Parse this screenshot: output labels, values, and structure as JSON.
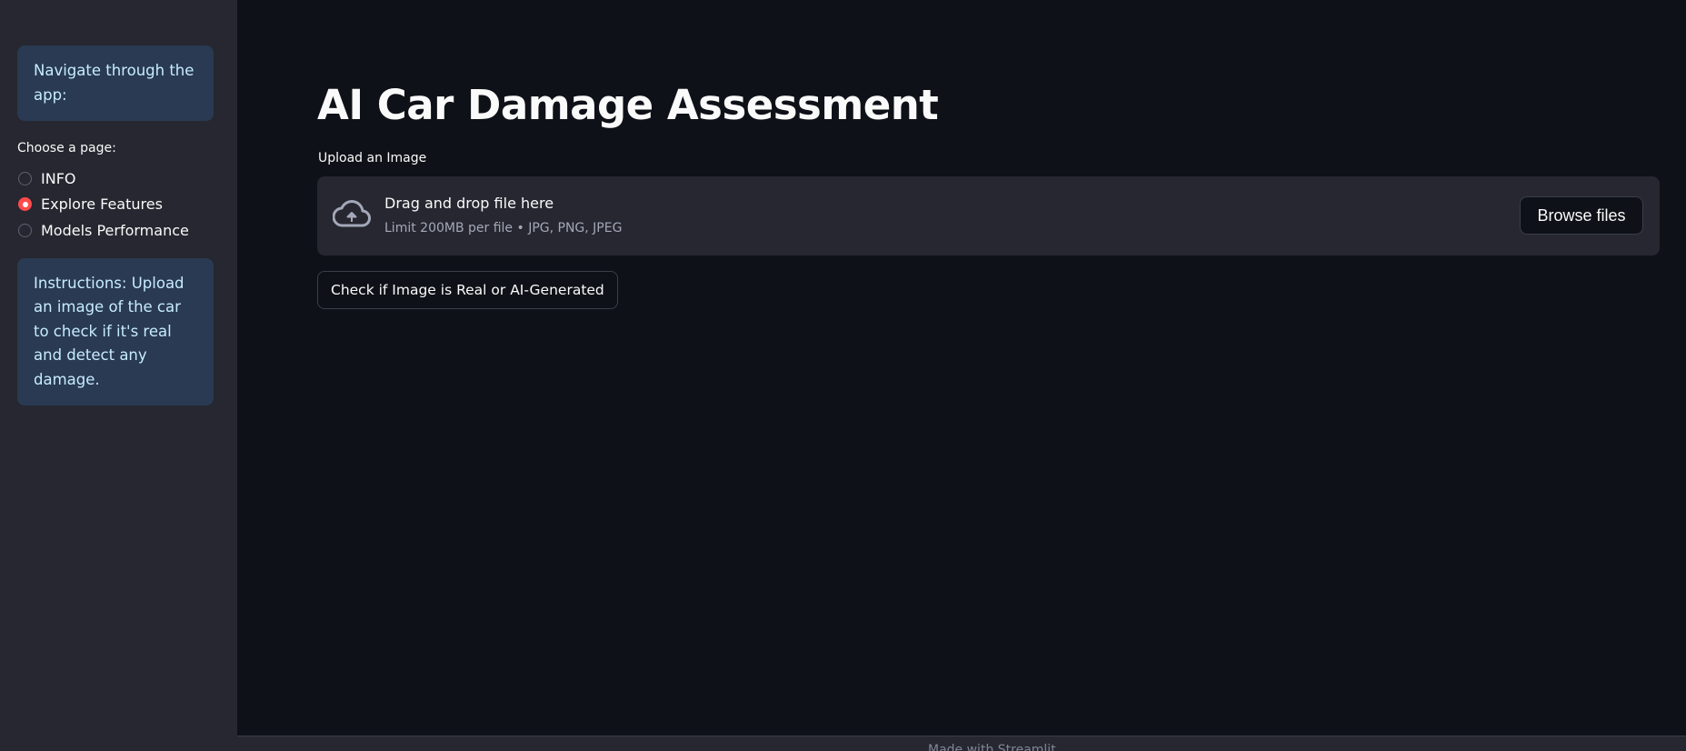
{
  "sidebar": {
    "nav_info": "Navigate through the app:",
    "radio": {
      "title": "Choose a page:",
      "options": [
        {
          "label": "INFO",
          "selected": false
        },
        {
          "label": "Explore Features",
          "selected": true
        },
        {
          "label": "Models Performance",
          "selected": false
        }
      ]
    },
    "instructions": "Instructions: Upload an image of the car to check if it's real and detect any damage."
  },
  "main": {
    "title": "AI Car Damage Assessment",
    "upload": {
      "label": "Upload an Image",
      "drop_title": "Drag and drop file here",
      "limit": "Limit 200MB per file • JPG, PNG, JPEG",
      "browse_label": "Browse files",
      "icon": "cloud-upload-icon"
    },
    "check_button": "Check if Image is Real or AI-Generated"
  },
  "footer": {
    "text": "Made with Streamlit"
  },
  "colors": {
    "background": "#0e1117",
    "sidebar": "#262730",
    "info_box": "#293a52",
    "accent": "#ff4b4b"
  }
}
